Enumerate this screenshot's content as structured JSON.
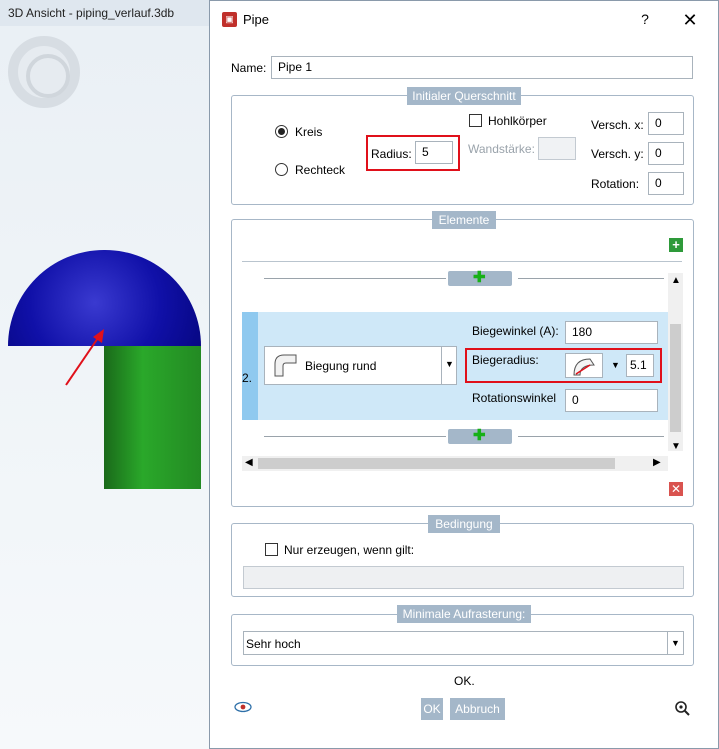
{
  "background": {
    "window_title": "3D Ansicht - piping_verlauf.3db"
  },
  "dialog": {
    "title": "Pipe",
    "help_glyph": "?",
    "close_glyph": "✕",
    "name_label": "Name:",
    "name_value": "Pipe 1",
    "initial_cross_section": {
      "title": "Initialer Querschnitt",
      "circle_label": "Kreis",
      "rectangle_label": "Rechteck",
      "selected": "circle",
      "radius_label": "Radius:",
      "radius_value": "5",
      "hollow_label": "Hohlkörper",
      "wall_label": "Wandstärke:",
      "offset_x_label": "Versch. x:",
      "offset_x_value": "0",
      "offset_y_label": "Versch. y:",
      "offset_y_value": "0",
      "rotation_label": "Rotation:",
      "rotation_value": "0"
    },
    "elements": {
      "title": "Elemente",
      "row_index": "2.",
      "type_value": "Biegung rund",
      "bend_angle_label": "Biegewinkel (A):",
      "bend_angle_value": "180",
      "bend_radius_label": "Biegeradius:",
      "bend_radius_value": "5.1",
      "rotation_angle_label": "Rotationswinkel",
      "rotation_angle_value": "0"
    },
    "condition": {
      "title": "Bedingung",
      "only_create_label": "Nur erzeugen, wenn gilt:"
    },
    "rasterization": {
      "title": "Minimale Aufrasterung:",
      "selected_value": "Sehr hoch"
    },
    "status_text": "OK.",
    "ok_label": "OK",
    "cancel_label": "Abbruch"
  },
  "colors": {
    "group_header": "#a4b7c9",
    "highlight": "#e0101a",
    "row_selection": "#cfe8f8",
    "pipe_blue": "#1010a8",
    "pipe_green": "#2aa82a"
  }
}
